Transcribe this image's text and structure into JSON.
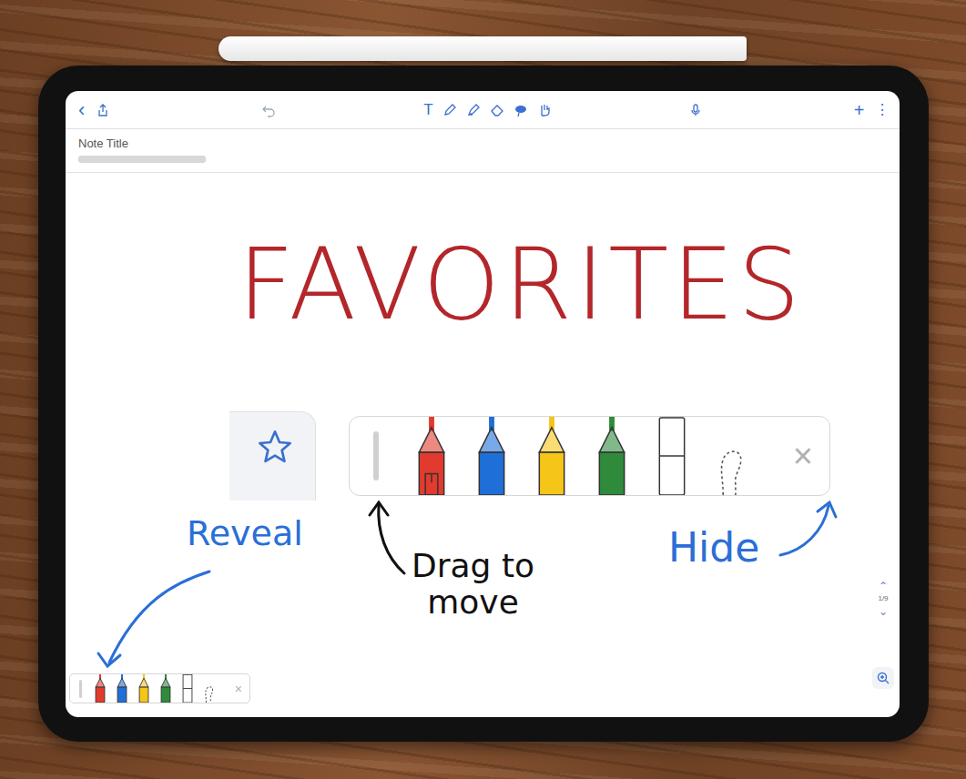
{
  "toolbar": {
    "back": "‹",
    "text_tool": "T",
    "add": "+",
    "more": "⋮"
  },
  "note": {
    "title": "Note Title"
  },
  "canvas": {
    "heading": "FAVORITES",
    "annotations": [
      {
        "lines": [
          "Reveal"
        ],
        "color": "#2a6fd6"
      },
      {
        "lines": [
          "Drag to",
          "move"
        ],
        "color": "#111111"
      },
      {
        "lines": [
          "Hide"
        ],
        "color": "#2a6fd6"
      }
    ]
  },
  "favorites_bar": {
    "tools": [
      {
        "kind": "pen",
        "color": "#e23a2e",
        "selected": true
      },
      {
        "kind": "pen",
        "color": "#1f6fd8",
        "selected": false
      },
      {
        "kind": "pen",
        "color": "#f5c518",
        "selected": false
      },
      {
        "kind": "pen",
        "color": "#2f8a3c",
        "selected": false
      },
      {
        "kind": "marker",
        "color": "#ffffff",
        "selected": false
      },
      {
        "kind": "lasso",
        "color": "#555555",
        "selected": false
      }
    ],
    "close": "×"
  },
  "page_nav": {
    "up": "⌃",
    "page": "1/9",
    "down": "⌄"
  }
}
